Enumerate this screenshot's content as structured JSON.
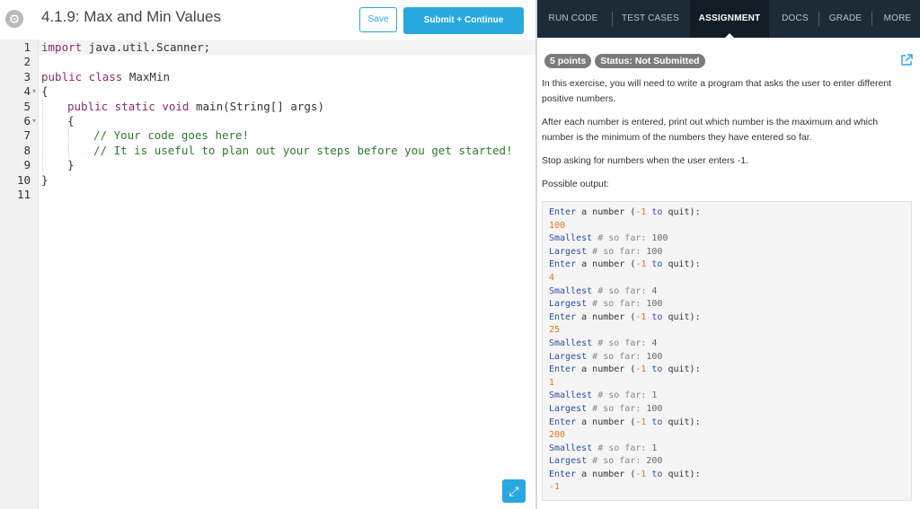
{
  "header": {
    "title": "4.1.9: Max and Min Values",
    "save_label": "Save",
    "submit_label": "Submit + Continue"
  },
  "editor": {
    "line_numbers": [
      "1",
      "2",
      "3",
      "4",
      "5",
      "6",
      "7",
      "8",
      "9",
      "10",
      "11"
    ],
    "lines": {
      "l1_kw": "import",
      "l1_rest": " java.util.Scanner;",
      "l3_kw": "public class",
      "l3_rest": " MaxMin",
      "l4": "{",
      "l5_kw1": "public static void",
      "l5_rest": " main(String[] args)",
      "l6": "{",
      "l7": "// Your code goes here!",
      "l8": "// It is useful to plan out your steps before you get started!",
      "l9": "}",
      "l10": "}"
    }
  },
  "tabs": [
    "RUN CODE",
    "TEST CASES",
    "ASSIGNMENT",
    "DOCS",
    "GRADE",
    "MORE"
  ],
  "active_tab": "ASSIGNMENT",
  "assignment": {
    "points_badge": "5 points",
    "status_badge": "Status: Not Submitted",
    "para1": "In this exercise, you will need to write a program that asks the user to enter different positive numbers.",
    "para2": "After each number is entered, print out which number is the maximum and which number is the minimum of the numbers they have entered so far.",
    "para3": "Stop asking for numbers when the user enters -1.",
    "para4": "Possible output:",
    "output": [
      {
        "kind": "prompt"
      },
      {
        "kind": "input",
        "value": "100"
      },
      {
        "kind": "small",
        "value": "100"
      },
      {
        "kind": "large",
        "value": "100"
      },
      {
        "kind": "prompt"
      },
      {
        "kind": "input",
        "value": "4"
      },
      {
        "kind": "small",
        "value": "4"
      },
      {
        "kind": "large",
        "value": "100"
      },
      {
        "kind": "prompt"
      },
      {
        "kind": "input",
        "value": "25"
      },
      {
        "kind": "small",
        "value": "4"
      },
      {
        "kind": "large",
        "value": "100"
      },
      {
        "kind": "prompt"
      },
      {
        "kind": "input",
        "value": "1"
      },
      {
        "kind": "small",
        "value": "1"
      },
      {
        "kind": "large",
        "value": "100"
      },
      {
        "kind": "prompt"
      },
      {
        "kind": "input",
        "value": "200"
      },
      {
        "kind": "small",
        "value": "1"
      },
      {
        "kind": "large",
        "value": "200"
      },
      {
        "kind": "prompt"
      },
      {
        "kind": "input",
        "value": "-1"
      }
    ],
    "prompt_text": {
      "word1": "Enter",
      "mid": " a number (",
      "num": "-1",
      "to": " to",
      "end": " quit):"
    },
    "smallest_word": "Smallest",
    "largest_word": "Largest",
    "sofar_text": " # so far: "
  },
  "colors": {
    "accent": "#28a8df",
    "tabbar": "#1d2b37"
  },
  "icons": {
    "settings": "gear-icon",
    "external": "external-link-icon",
    "expand": "expand-icon"
  }
}
